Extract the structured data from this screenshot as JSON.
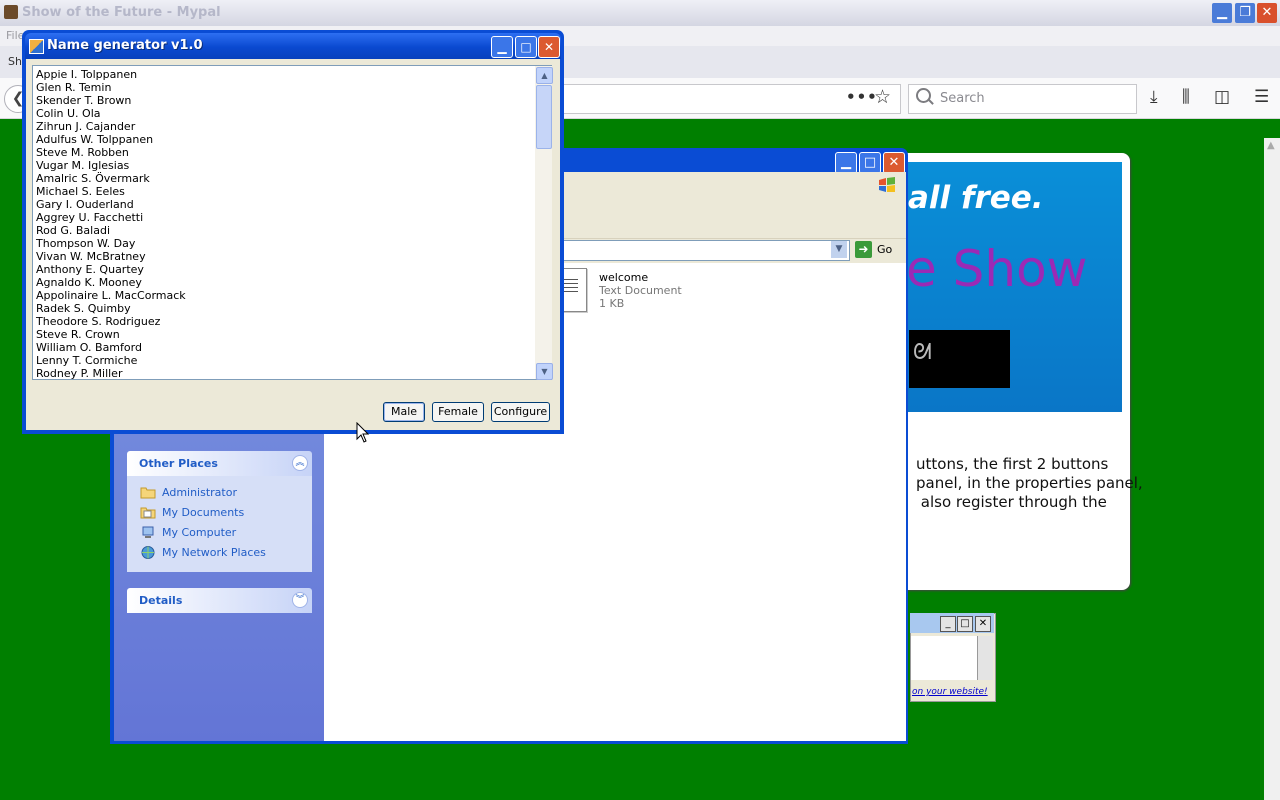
{
  "browser": {
    "title": "Show of the Future - Mypal",
    "menu_file": "File",
    "tab_label": "Sh",
    "search_placeholder": "Search"
  },
  "webpage": {
    "heading": "all free.",
    "show_text": "e Show",
    "paragraph": "uttons, the first 2 buttons\npanel, in the properties panel,\n also register through the",
    "popup_link": "on your website!"
  },
  "explorer": {
    "address_go": "Go",
    "other_places": {
      "title": "Other Places",
      "items": [
        "Administrator",
        "My Documents",
        "My Computer",
        "My Network Places"
      ]
    },
    "details_title": "Details",
    "file": {
      "name": "welcome",
      "type": "Text Document",
      "size": "1 KB"
    }
  },
  "name_generator": {
    "title": "Name generator v1.0",
    "names": [
      "Appie I. Tolppanen",
      "Glen R. Temin",
      "Skender T. Brown",
      "Colin U. Ola",
      "Zihrun J. Cajander",
      "Adulfus W. Tolppanen",
      "Steve M. Robben",
      "Vugar M. Iglesias",
      "Amalric S. Övermark",
      "Michael S. Eeles",
      "Gary I. Ouderland",
      "Aggrey U. Facchetti",
      "Rod G. Baladi",
      "Thompson W. Day",
      "Vivan W. McBratney",
      "Anthony E. Quartey",
      "Agnaldo K. Mooney",
      "Appolinaire L. MacCormack",
      "Radek S. Quimby",
      "Theodore S. Rodriguez",
      "Steve R. Crown",
      "William O. Bamford",
      "Lenny T. Cormiche",
      "Rodney P. Miller"
    ],
    "buttons": {
      "male": "Male",
      "female": "Female",
      "configure": "Configure"
    }
  }
}
